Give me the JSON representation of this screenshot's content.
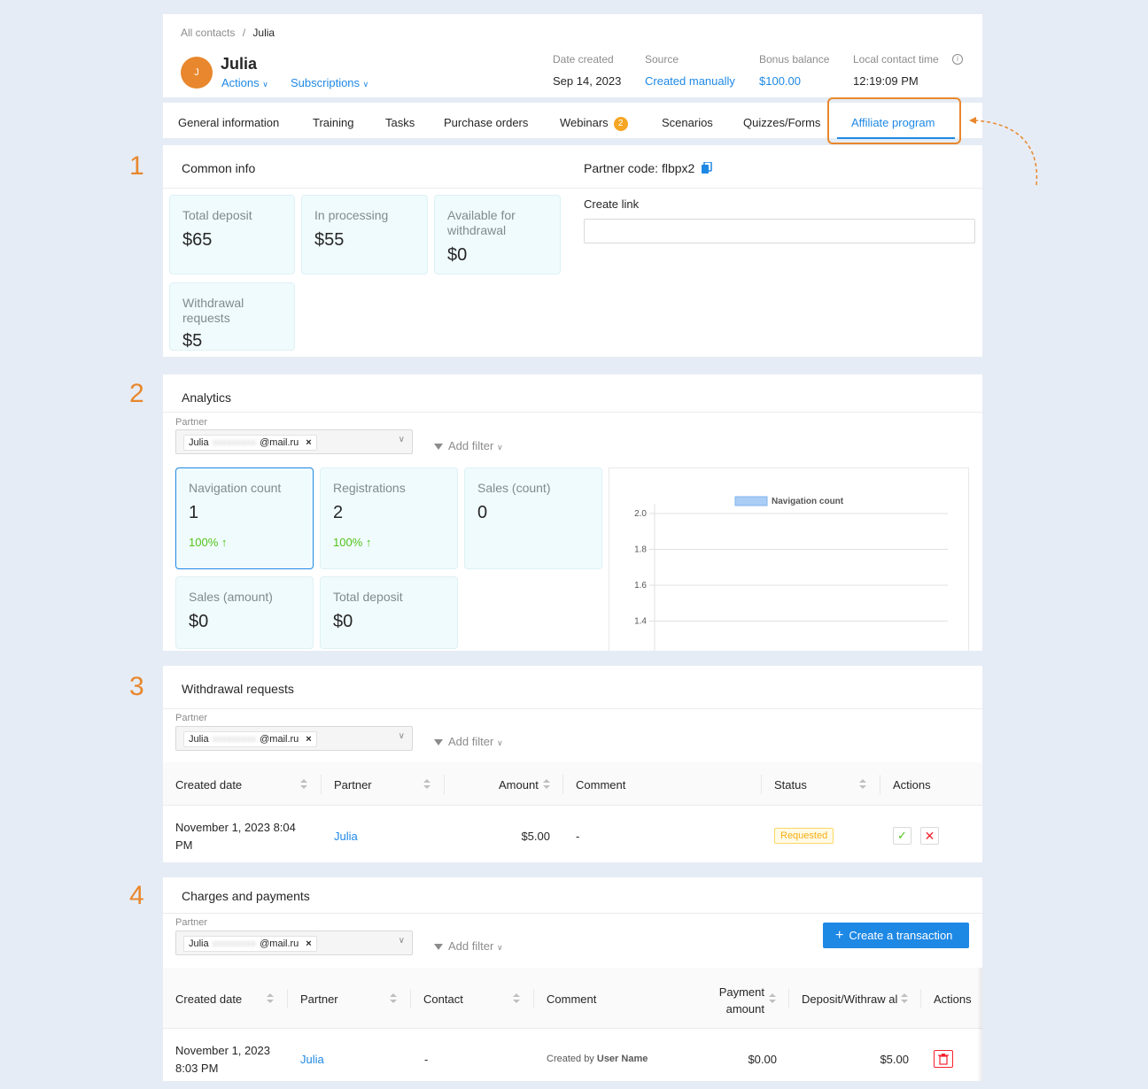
{
  "header": {
    "breadcrumb_root": "All contacts",
    "breadcrumb_sep": "/",
    "breadcrumb_current": "Julia",
    "avatar_letter": "J",
    "name": "Julia",
    "actions_label": "Actions",
    "subscriptions_label": "Subscriptions",
    "meta": [
      {
        "label": "Date created",
        "value": "Sep 14, 2023"
      },
      {
        "label": "Source",
        "value": "Created manually"
      },
      {
        "label": "Bonus balance",
        "value": "$100.00"
      },
      {
        "label": "Local contact time",
        "value": "12:19:09 PM"
      }
    ]
  },
  "tabs": [
    {
      "label": "General information"
    },
    {
      "label": "Training"
    },
    {
      "label": "Tasks"
    },
    {
      "label": "Purchase orders"
    },
    {
      "label": "Webinars",
      "badge": "2"
    },
    {
      "label": "Scenarios"
    },
    {
      "label": "Quizzes/Forms"
    },
    {
      "label": "Affiliate program",
      "active": true
    }
  ],
  "steps": [
    "1",
    "2",
    "3",
    "4"
  ],
  "common": {
    "title": "Common info",
    "partner_code_label": "Partner code: flbpx2",
    "create_link_label": "Create link",
    "create_link_value": "",
    "cards": [
      {
        "label": "Total deposit",
        "value": "$65"
      },
      {
        "label": "In processing",
        "value": "$55"
      },
      {
        "label": "Available for withdrawal",
        "value": "$0"
      },
      {
        "label": "Withdrawal requests",
        "value": "$5"
      }
    ]
  },
  "analytics": {
    "title": "Analytics",
    "partner_label": "Partner",
    "chip_name": "Julia",
    "chip_email": "@mail.ru",
    "add_filter": "Add filter",
    "cards": [
      {
        "label": "Navigation count",
        "value": "1",
        "delta": "100%"
      },
      {
        "label": "Registrations",
        "value": "2",
        "delta": "100%"
      },
      {
        "label": "Sales (count)",
        "value": "0"
      },
      {
        "label": "Sales (amount)",
        "value": "$0"
      },
      {
        "label": "Total deposit",
        "value": "$0"
      }
    ]
  },
  "chart_data": {
    "type": "line",
    "series": [
      {
        "name": "Navigation count",
        "values": []
      }
    ],
    "yticks": [
      "2.0",
      "1.8",
      "1.6",
      "1.4"
    ],
    "legend": "top",
    "grid": true
  },
  "withdrawals": {
    "title": "Withdrawal requests",
    "partner_label": "Partner",
    "chip_name": "Julia",
    "chip_email": "@mail.ru",
    "add_filter": "Add filter",
    "columns": [
      "Created date",
      "Partner",
      "Amount",
      "Comment",
      "Status",
      "Actions"
    ],
    "rows": [
      {
        "date": "November 1, 2023 8:04 PM",
        "partner": "Julia",
        "amount": "$5.00",
        "comment": "-",
        "status": "Requested"
      }
    ]
  },
  "charges": {
    "title": "Charges and payments",
    "partner_label": "Partner",
    "chip_name": "Julia",
    "chip_email": "@mail.ru",
    "add_filter": "Add filter",
    "create_button": "Create a transaction",
    "columns": [
      "Created date",
      "Partner",
      "Contact",
      "Comment",
      "Payment amount",
      "Deposit/Withraw al",
      "Actions"
    ],
    "rows": [
      {
        "date": "November 1, 2023 8:03 PM",
        "partner": "Julia",
        "contact": "-",
        "comment_prefix": "Created by",
        "comment_user": "User Name",
        "payment": "$0.00",
        "deposit": "$5.00"
      }
    ]
  }
}
